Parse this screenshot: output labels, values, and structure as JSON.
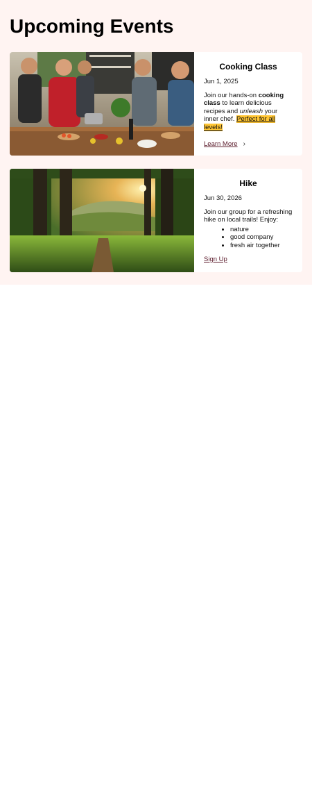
{
  "page": {
    "title": "Upcoming Events"
  },
  "events": [
    {
      "title": "Cooking Class",
      "date": "Jun 1, 2025",
      "desc_part1": "Join our hands-on ",
      "desc_bold": "cooking class",
      "desc_part2": " to learn delicious recipes and ",
      "desc_italic": "unleash",
      "desc_part3": " your inner chef.",
      "highlight": "Perfect for all levels!",
      "link_label": "Learn More",
      "link_icon": "chevron-right-icon",
      "image_icon": "cooking-class-photo"
    },
    {
      "title": "Hike",
      "date": "Jun 30, 2026",
      "description": "Join our group for a refreshing hike on local trails! Enjoy:",
      "list": [
        "nature",
        "good company",
        "fresh air together"
      ],
      "link_label": "Sign Up",
      "image_icon": "forest-trail-photo"
    }
  ],
  "colors": {
    "page_bg": "#fff4f2",
    "highlight": "#ffc533",
    "link": "#5a1a2a"
  }
}
